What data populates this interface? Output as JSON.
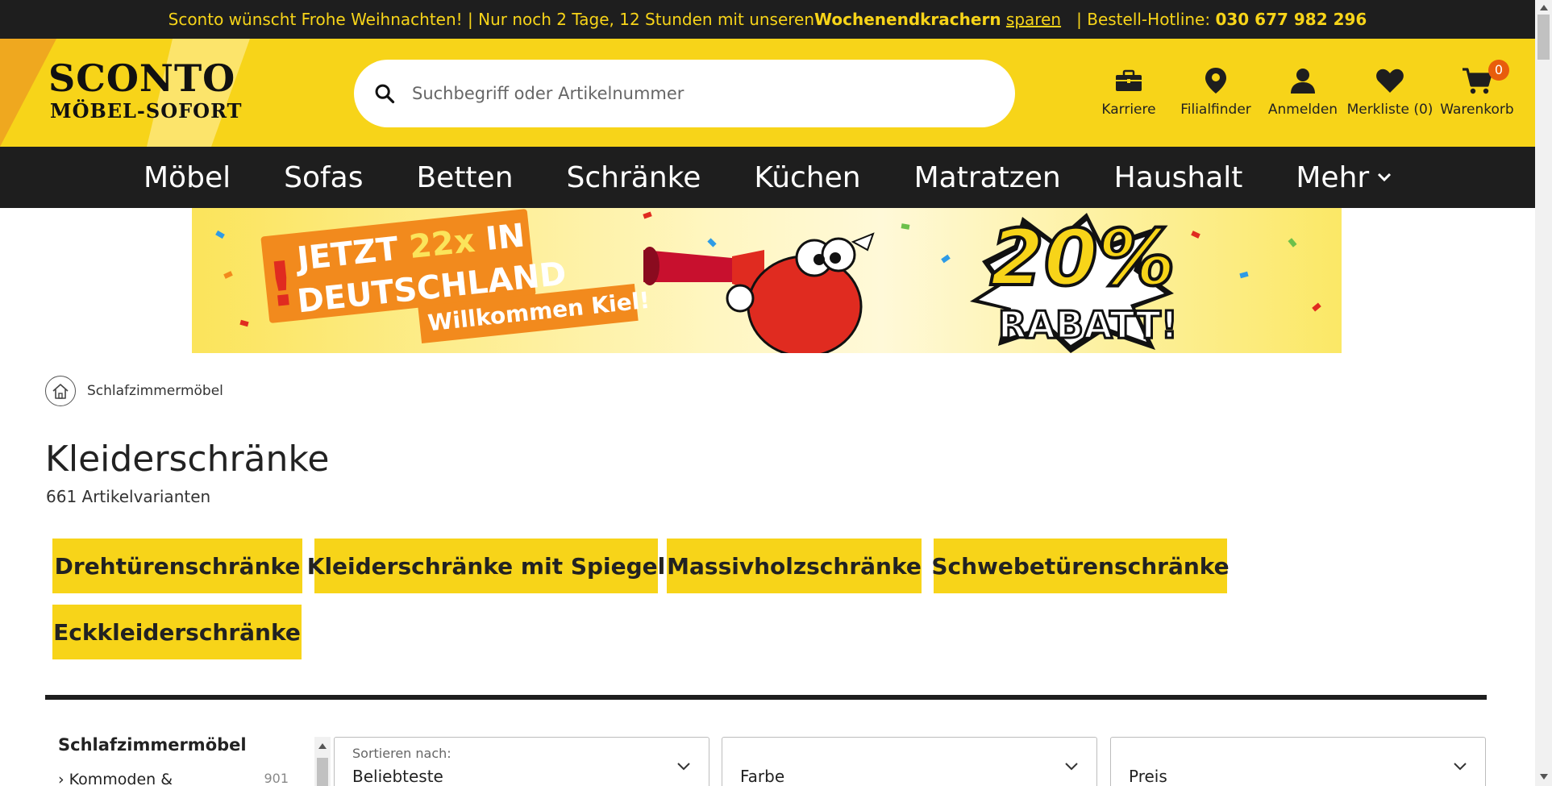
{
  "promo_bar": {
    "part1": "Sconto wünscht Frohe Weihnachten! | Nur noch 2 Tage, 12 Stunden mit unseren ",
    "bold": "Wochenendkrachern",
    "link": "sparen",
    "gap": "   | Bestell-Hotline: ",
    "hotline": "030 677 982 296"
  },
  "logo": {
    "line1": "SCONTO",
    "line2": "MÖBEL-SOFORT"
  },
  "search": {
    "placeholder": "Suchbegriff oder Artikelnummer"
  },
  "header_icons": [
    {
      "label": "Karriere",
      "icon": "briefcase-icon"
    },
    {
      "label": "Filialfinder",
      "icon": "location-pin-icon"
    },
    {
      "label": "Anmelden",
      "icon": "user-icon"
    },
    {
      "label": "Merkliste (0)",
      "icon": "heart-icon"
    },
    {
      "label": "Warenkorb",
      "icon": "cart-icon",
      "badge": "0"
    }
  ],
  "category_nav": [
    "Möbel",
    "Sofas",
    "Betten",
    "Schränke",
    "Küchen",
    "Matratzen",
    "Haushalt",
    "Mehr"
  ],
  "banner": {
    "line1_a": "JETZT ",
    "line1_b": "22x",
    "line1_c": " IN",
    "line2": "DEUTSCHLAND",
    "line3": "Willkommen Kiel!",
    "excl": "!",
    "percent": "20%",
    "rabatt": "RABATT!"
  },
  "breadcrumb": {
    "item": "Schlafzimmermöbel"
  },
  "page": {
    "title": "Kleiderschränke",
    "count": "661 Artikelvarianten"
  },
  "chips": [
    "Drehtürenschränke",
    "Kleiderschränke mit Spiegel",
    "Massivholzschränke",
    "Schwebetürenschränke",
    "Eckkleiderschränke"
  ],
  "sidebar": {
    "heading": "Schlafzimmermöbel",
    "items": [
      {
        "label": "› Kommoden &",
        "count": "901"
      }
    ]
  },
  "filters": {
    "sort_label": "Sortieren nach:",
    "sort_value": "Beliebteste",
    "color": "Farbe",
    "price": "Preis"
  },
  "colors": {
    "yellow": "#f7d419",
    "dark": "#1e1e1e",
    "badge": "#e85d0c"
  }
}
